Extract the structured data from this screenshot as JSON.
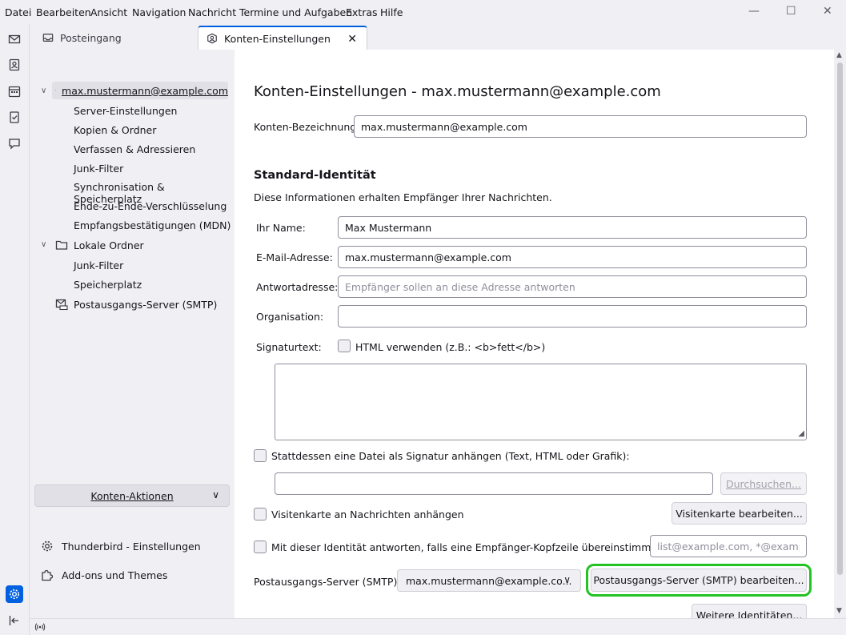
{
  "menu": [
    "Datei",
    "Bearbeiten",
    "Ansicht",
    "Navigation",
    "Nachricht",
    "Termine und Aufgaben",
    "Extras",
    "Hilfe"
  ],
  "window": {
    "minimize": "—",
    "maximize": "☐",
    "close": "✕"
  },
  "tabs": {
    "inbox": "Posteingang",
    "settings": "Konten-Einstellungen",
    "close": "✕"
  },
  "sidebar": {
    "account": "max.mustermann@example.com",
    "account_items": [
      "Server-Einstellungen",
      "Kopien & Ordner",
      "Verfassen & Adressieren",
      "Junk-Filter",
      "Synchronisation & Speicherplatz",
      "Ende-zu-Ende-Verschlüsselung",
      "Empfangsbestätigungen (MDN)"
    ],
    "local_folders": "Lokale Ordner",
    "local_items": [
      "Junk-Filter",
      "Speicherplatz"
    ],
    "smtp": "Postausgangs-Server (SMTP)",
    "account_actions": "Konten-Aktionen",
    "tb_settings": "Thunderbird - Einstellungen",
    "addons": "Add-ons und Themes"
  },
  "main": {
    "title": "Konten-Einstellungen - max.mustermann@example.com",
    "account_name_label": "Konten-Bezeichnung:",
    "account_name_value": "max.mustermann@example.com",
    "identity_heading": "Standard-Identität",
    "identity_desc": "Diese Informationen erhalten Empfänger Ihrer Nachrichten.",
    "name_label": "Ihr Name:",
    "name_value": "Max Mustermann",
    "email_label": "E-Mail-Adresse:",
    "email_value": "max.mustermann@example.com",
    "reply_label": "Antwortadresse:",
    "reply_placeholder": "Empfänger sollen an diese Adresse antworten",
    "org_label": "Organisation:",
    "org_value": "",
    "sig_label": "Signaturtext:",
    "html_label": "HTML verwenden (z.B.: <b>fett</b>)",
    "sigfile_label": "Stattdessen eine Datei als Signatur anhängen (Text, HTML oder Grafik):",
    "browse": "Durchsuchen...",
    "vcard_label": "Visitenkarte an Nachrichten anhängen",
    "vcard_edit": "Visitenkarte bearbeiten...",
    "match_label": "Mit dieser Identität antworten, falls eine Empfänger-Kopfzeile übereinstimmt mit:",
    "match_placeholder": "list@example.com, *@example",
    "smtp_label": "Postausgangs-Server (SMTP):",
    "smtp_value": "max.mustermann@example.co...",
    "smtp_edit": "Postausgangs-Server (SMTP) bearbeiten...",
    "more_identities": "Weitere Identitäten..."
  }
}
